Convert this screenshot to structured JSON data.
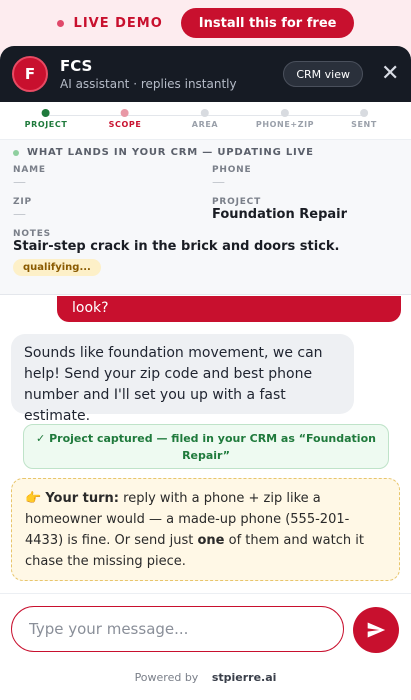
{
  "banner": {
    "live_label": "LIVE DEMO",
    "install_label": "Install this for free"
  },
  "header": {
    "avatar_letter": "F",
    "title": "FCS",
    "subtitle": "AI assistant · replies instantly",
    "crm_button": "CRM view",
    "close": "✕"
  },
  "steps": [
    {
      "label": "PROJECT",
      "state": "done"
    },
    {
      "label": "SCOPE",
      "state": "active"
    },
    {
      "label": "AREA",
      "state": "pending"
    },
    {
      "label": "PHONE+ZIP",
      "state": "pending"
    },
    {
      "label": "SENT",
      "state": "pending"
    }
  ],
  "crm": {
    "title": "WHAT LANDS IN YOUR CRM — UPDATING LIVE",
    "name_label": "NAME",
    "name_value": "—",
    "phone_label": "PHONE",
    "phone_value": "—",
    "zip_label": "ZIP",
    "zip_value": "—",
    "project_label": "PROJECT",
    "project_value": "Foundation Repair",
    "notes_label": "NOTES",
    "notes_value": "Stair-step crack in the brick and doors stick.",
    "status_badge": "qualifying..."
  },
  "chat": {
    "user_partial": "look?",
    "bot_message": "Sounds like foundation movement, we can help! Send your zip code and best phone number and I'll set you up with a fast estimate.",
    "captured_notice": "✓ Project captured — filed in your CRM as “Foundation Repair”",
    "turn_emoji": "👉",
    "turn_lead": "Your turn:",
    "turn_text_1": "reply with a phone + zip like a homeowner would — a made-up phone (555-201-4433) is fine. Or send just",
    "turn_one": "one",
    "turn_text_2": "of them and watch it chase the missing piece."
  },
  "composer": {
    "placeholder": "Type your message...",
    "powered_by": "Powered by",
    "brand": "stpierre.ai"
  },
  "colors": {
    "accent": "#c8102e",
    "header_bg": "#161b24",
    "success": "#1f7a3c"
  }
}
